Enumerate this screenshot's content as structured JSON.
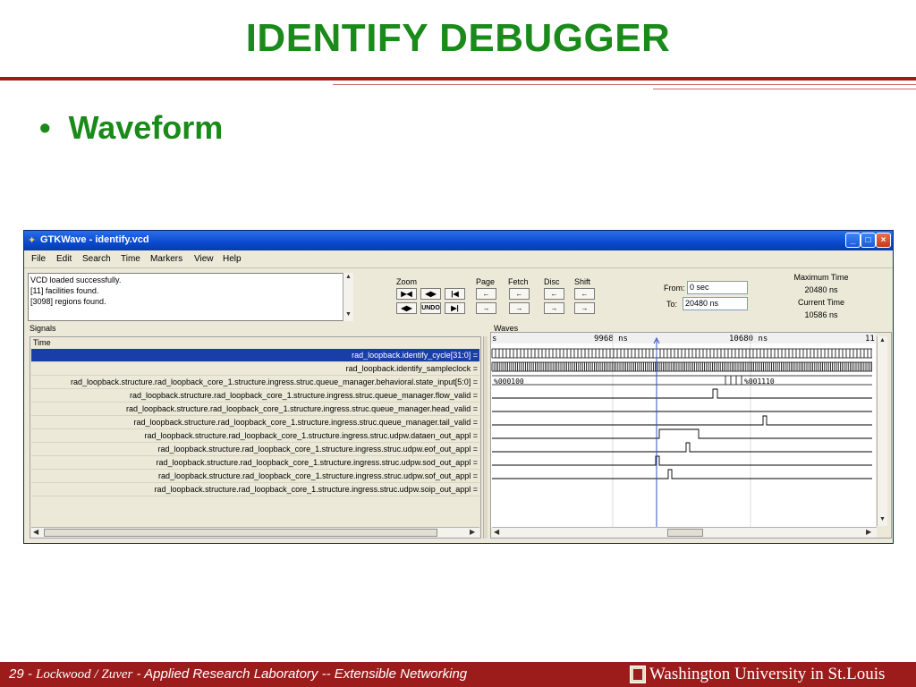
{
  "slide": {
    "title": "IDENTIFY DEBUGGER",
    "bullet": "Waveform",
    "footer": {
      "page": "29 - ",
      "authors": "Lockwood / Zuver",
      "separator": " - ",
      "lab": "Applied Research Laboratory -- Extensible Networking",
      "university": "Washington University in St.Louis"
    }
  },
  "window": {
    "title": "GTKWave - identify.vcd",
    "buttons": {
      "minimize": "_",
      "maximize": "□",
      "close": "×"
    },
    "menu": [
      "File",
      "Edit",
      "Search",
      "Time",
      "Markers",
      "View",
      "Help"
    ],
    "status_lines": [
      "VCD loaded successfully.",
      "[11] facilities found.",
      "[3098] regions found."
    ],
    "toolbar": {
      "zoom_label": "Zoom",
      "page_label": "Page",
      "fetch_label": "Fetch",
      "disc_label": "Disc",
      "shift_label": "Shift",
      "undo_label": "UNDO"
    },
    "from_label": "From:",
    "from_value": "0 sec",
    "to_label": "To:",
    "to_value": "20480 ns",
    "max_time_label": "Maximum Time",
    "max_time_value": "20480 ns",
    "current_time_label": "Current Time",
    "current_time_value": "10586 ns",
    "signals_label": "Signals",
    "signals_header": "Time",
    "signals": [
      "rad_loopback.identify_cycle[31:0] =",
      "rad_loopback.identify_sampleclock =",
      "rad_loopback.structure.rad_loopback_core_1.structure.ingress.struc.queue_manager.behavioral.state_input[5:0] =",
      "rad_loopback.structure.rad_loopback_core_1.structure.ingress.struc.queue_manager.flow_valid =",
      "rad_loopback.structure.rad_loopback_core_1.structure.ingress.struc.queue_manager.head_valid =",
      "rad_loopback.structure.rad_loopback_core_1.structure.ingress.struc.queue_manager.tail_valid =",
      "rad_loopback.structure.rad_loopback_core_1.structure.ingress.struc.udpw.dataen_out_appl =",
      "rad_loopback.structure.rad_loopback_core_1.structure.ingress.struc.udpw.eof_out_appl =",
      "rad_loopback.structure.rad_loopback_core_1.structure.ingress.struc.udpw.sod_out_appl =",
      "rad_loopback.structure.rad_loopback_core_1.structure.ingress.struc.udpw.sof_out_appl =",
      "rad_loopback.structure.rad_loopback_core_1.structure.ingress.struc.udpw.soip_out_appl ="
    ],
    "waves_label": "Waves",
    "ruler": {
      "left_fragment": "s",
      "t1": "9968 ns",
      "t2": "10680 ns",
      "right_fragment": "11"
    },
    "bus_values": {
      "state_before": "%000100",
      "state_after": "%001110"
    }
  }
}
